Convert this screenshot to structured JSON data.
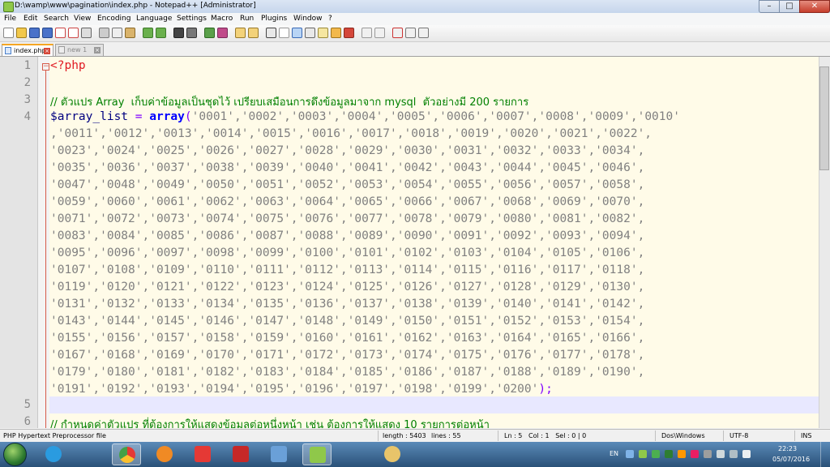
{
  "window": {
    "title": "D:\\wamp\\www\\pagination\\index.php - Notepad++ [Administrator]",
    "buttons": {
      "minimize": "–",
      "maximize": "□",
      "close": "✕"
    }
  },
  "menu": [
    "File",
    "Edit",
    "Search",
    "View",
    "Encoding",
    "Language",
    "Settings",
    "Macro",
    "Run",
    "Plugins",
    "Window",
    "?"
  ],
  "toolbar": {
    "icons": [
      "new-icon",
      "open-icon",
      "save-icon",
      "save-all-icon",
      "close-icon",
      "close-all-icon",
      "print-icon",
      "cut-icon",
      "copy-icon",
      "paste-icon",
      "undo-icon",
      "redo-icon",
      "find-icon",
      "replace-icon",
      "zoom-in-icon",
      "zoom-out-icon",
      "sync-v-icon",
      "sync-h-icon",
      "word-wrap-icon",
      "show-all-chars-icon",
      "indent-guide-icon",
      "doc-map-icon",
      "function-list-icon",
      "folder-icon",
      "monitor-icon",
      "record-macro-icon",
      "stop-macro-icon",
      "play-macro-icon",
      "run-macro-multiple-icon",
      "save-macro-icon"
    ]
  },
  "tabs": [
    {
      "label": "index.php",
      "active": true
    },
    {
      "label": "new 1",
      "active": false
    }
  ],
  "editor": {
    "line_numbers": [
      "1",
      "2",
      "3",
      "4",
      "5",
      "6"
    ],
    "line1": "<?php",
    "comment3": "// ตัวแปร Array  เก็บค่าข้อมูลเป็นชุดไว้ เปรียบเสมือนการดึงข้อมูลมาจาก mysql  ตัวอย่างมี 200 รายการ",
    "line4_var": "$array_list",
    "line4_eq": " = ",
    "line4_kw": "array",
    "line4_paren": "(",
    "line4_first": "'0001','0002','0003','0004','0005','0006','0007','0008','0009','0010'",
    "wrapped": [
      ",'0011','0012','0013','0014','0015','0016','0017','0018','0019','0020','0021','0022',",
      "'0023','0024','0025','0026','0027','0028','0029','0030','0031','0032','0033','0034',",
      "'0035','0036','0037','0038','0039','0040','0041','0042','0043','0044','0045','0046',",
      "'0047','0048','0049','0050','0051','0052','0053','0054','0055','0056','0057','0058',",
      "'0059','0060','0061','0062','0063','0064','0065','0066','0067','0068','0069','0070',",
      "'0071','0072','0073','0074','0075','0076','0077','0078','0079','0080','0081','0082',",
      "'0083','0084','0085','0086','0087','0088','0089','0090','0091','0092','0093','0094',",
      "'0095','0096','0097','0098','0099','0100','0101','0102','0103','0104','0105','0106',",
      "'0107','0108','0109','0110','0111','0112','0113','0114','0115','0116','0117','0118',",
      "'0119','0120','0121','0122','0123','0124','0125','0126','0127','0128','0129','0130',",
      "'0131','0132','0133','0134','0135','0136','0137','0138','0139','0140','0141','0142',",
      "'0143','0144','0145','0146','0147','0148','0149','0150','0151','0152','0153','0154',",
      "'0155','0156','0157','0158','0159','0160','0161','0162','0163','0164','0165','0166',",
      "'0167','0168','0169','0170','0171','0172','0173','0174','0175','0176','0177','0178',",
      "'0179','0180','0181','0182','0183','0184','0185','0186','0187','0188','0189','0190',"
    ],
    "last_strings": "'0191','0192','0193','0194','0195','0196','0197','0198','0199','0200'",
    "last_close": ");",
    "comment6": "// กำหนดค่าตัวแปร ที่ต้องการให้แสดงข้อมูลต่อหนึ่งหน้า เช่น ต้องการให้แสดง 10 รายการต่อหน้า"
  },
  "status": {
    "language": "PHP Hypertext Preprocessor file",
    "length": "length : 5403",
    "lines": "lines : 55",
    "position": "Ln : 5   Col : 1   Sel : 0 | 0",
    "eol": "Dos\\Windows",
    "encoding": "UTF-8",
    "mode": "INS"
  },
  "taskbar": {
    "apps": [
      "internet-explorer-icon",
      "chrome-icon",
      "media-player-icon",
      "pdf-reader-icon",
      "acrobat-icon",
      "network-tool-icon",
      "notepadplusplus-icon",
      "paint-icon"
    ],
    "tray": {
      "lang": "EN",
      "time": "22:23",
      "date": "05/07/2016"
    }
  },
  "colors": {
    "php_tag": "#e01b24",
    "comment": "#008000",
    "keyword": "#0000ff",
    "string": "#808080",
    "variable": "#000080",
    "operator": "#8000ff"
  }
}
